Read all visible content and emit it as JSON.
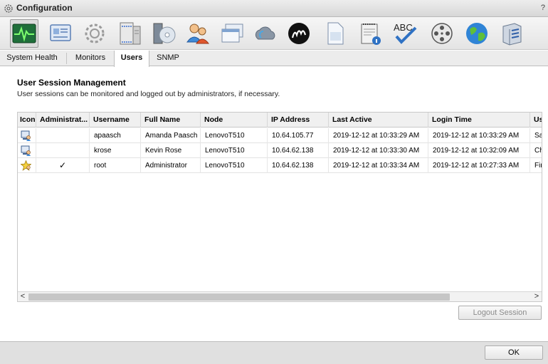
{
  "window": {
    "title": "Configuration",
    "help": "?"
  },
  "toolbar": {
    "buttons": [
      {
        "icon": "system-health-icon",
        "active": true
      },
      {
        "icon": "monitors-icon"
      },
      {
        "icon": "settings-gear-icon"
      },
      {
        "icon": "server-rack-icon"
      },
      {
        "icon": "disc-drive-icon"
      },
      {
        "icon": "users-icon"
      },
      {
        "icon": "windows-icon"
      },
      {
        "icon": "cloud-icon"
      },
      {
        "icon": "m-logo-icon"
      },
      {
        "icon": "document-icon"
      },
      {
        "icon": "notepad-info-icon"
      },
      {
        "icon": "spellcheck-icon"
      },
      {
        "icon": "film-reel-icon"
      },
      {
        "icon": "globe-icon"
      },
      {
        "icon": "storage-icon"
      }
    ]
  },
  "tabs": [
    "System Health",
    "Monitors",
    "Users",
    "SNMP"
  ],
  "selected_tab": "Users",
  "section": {
    "title": "User Session Management",
    "description": "User sessions can be monitored and logged out by administrators, if necessary."
  },
  "table": {
    "columns": [
      "Icon",
      "Administrat...",
      "Username",
      "Full Name",
      "Node",
      "IP Address",
      "Last Active",
      "Login Time",
      "Us"
    ],
    "rows": [
      {
        "icon": "user-session-icon",
        "admin": "",
        "username": "apaasch",
        "full_name": "Amanda Paasch",
        "node": "LenovoT510",
        "ip": "10.64.105.77",
        "last_active": "2019-12-12 at 10:33:29 AM",
        "login_time": "2019-12-12 at 10:33:29 AM",
        "us": "Sa"
      },
      {
        "icon": "user-session-icon",
        "admin": "",
        "username": "krose",
        "full_name": "Kevin Rose",
        "node": "LenovoT510",
        "ip": "10.64.62.138",
        "last_active": "2019-12-12 at 10:33:30 AM",
        "login_time": "2019-12-12 at 10:32:09 AM",
        "us": "Ch"
      },
      {
        "icon": "admin-star-icon",
        "admin": "✓",
        "username": "root",
        "full_name": "Administrator",
        "node": "LenovoT510",
        "ip": "10.64.62.138",
        "last_active": "2019-12-12 at 10:33:34 AM",
        "login_time": "2019-12-12 at 10:27:33 AM",
        "us": "Fir"
      }
    ]
  },
  "scrollbar": {
    "left_arrow": "<",
    "right_arrow": ">"
  },
  "buttons": {
    "logout": "Logout Session",
    "ok": "OK"
  }
}
